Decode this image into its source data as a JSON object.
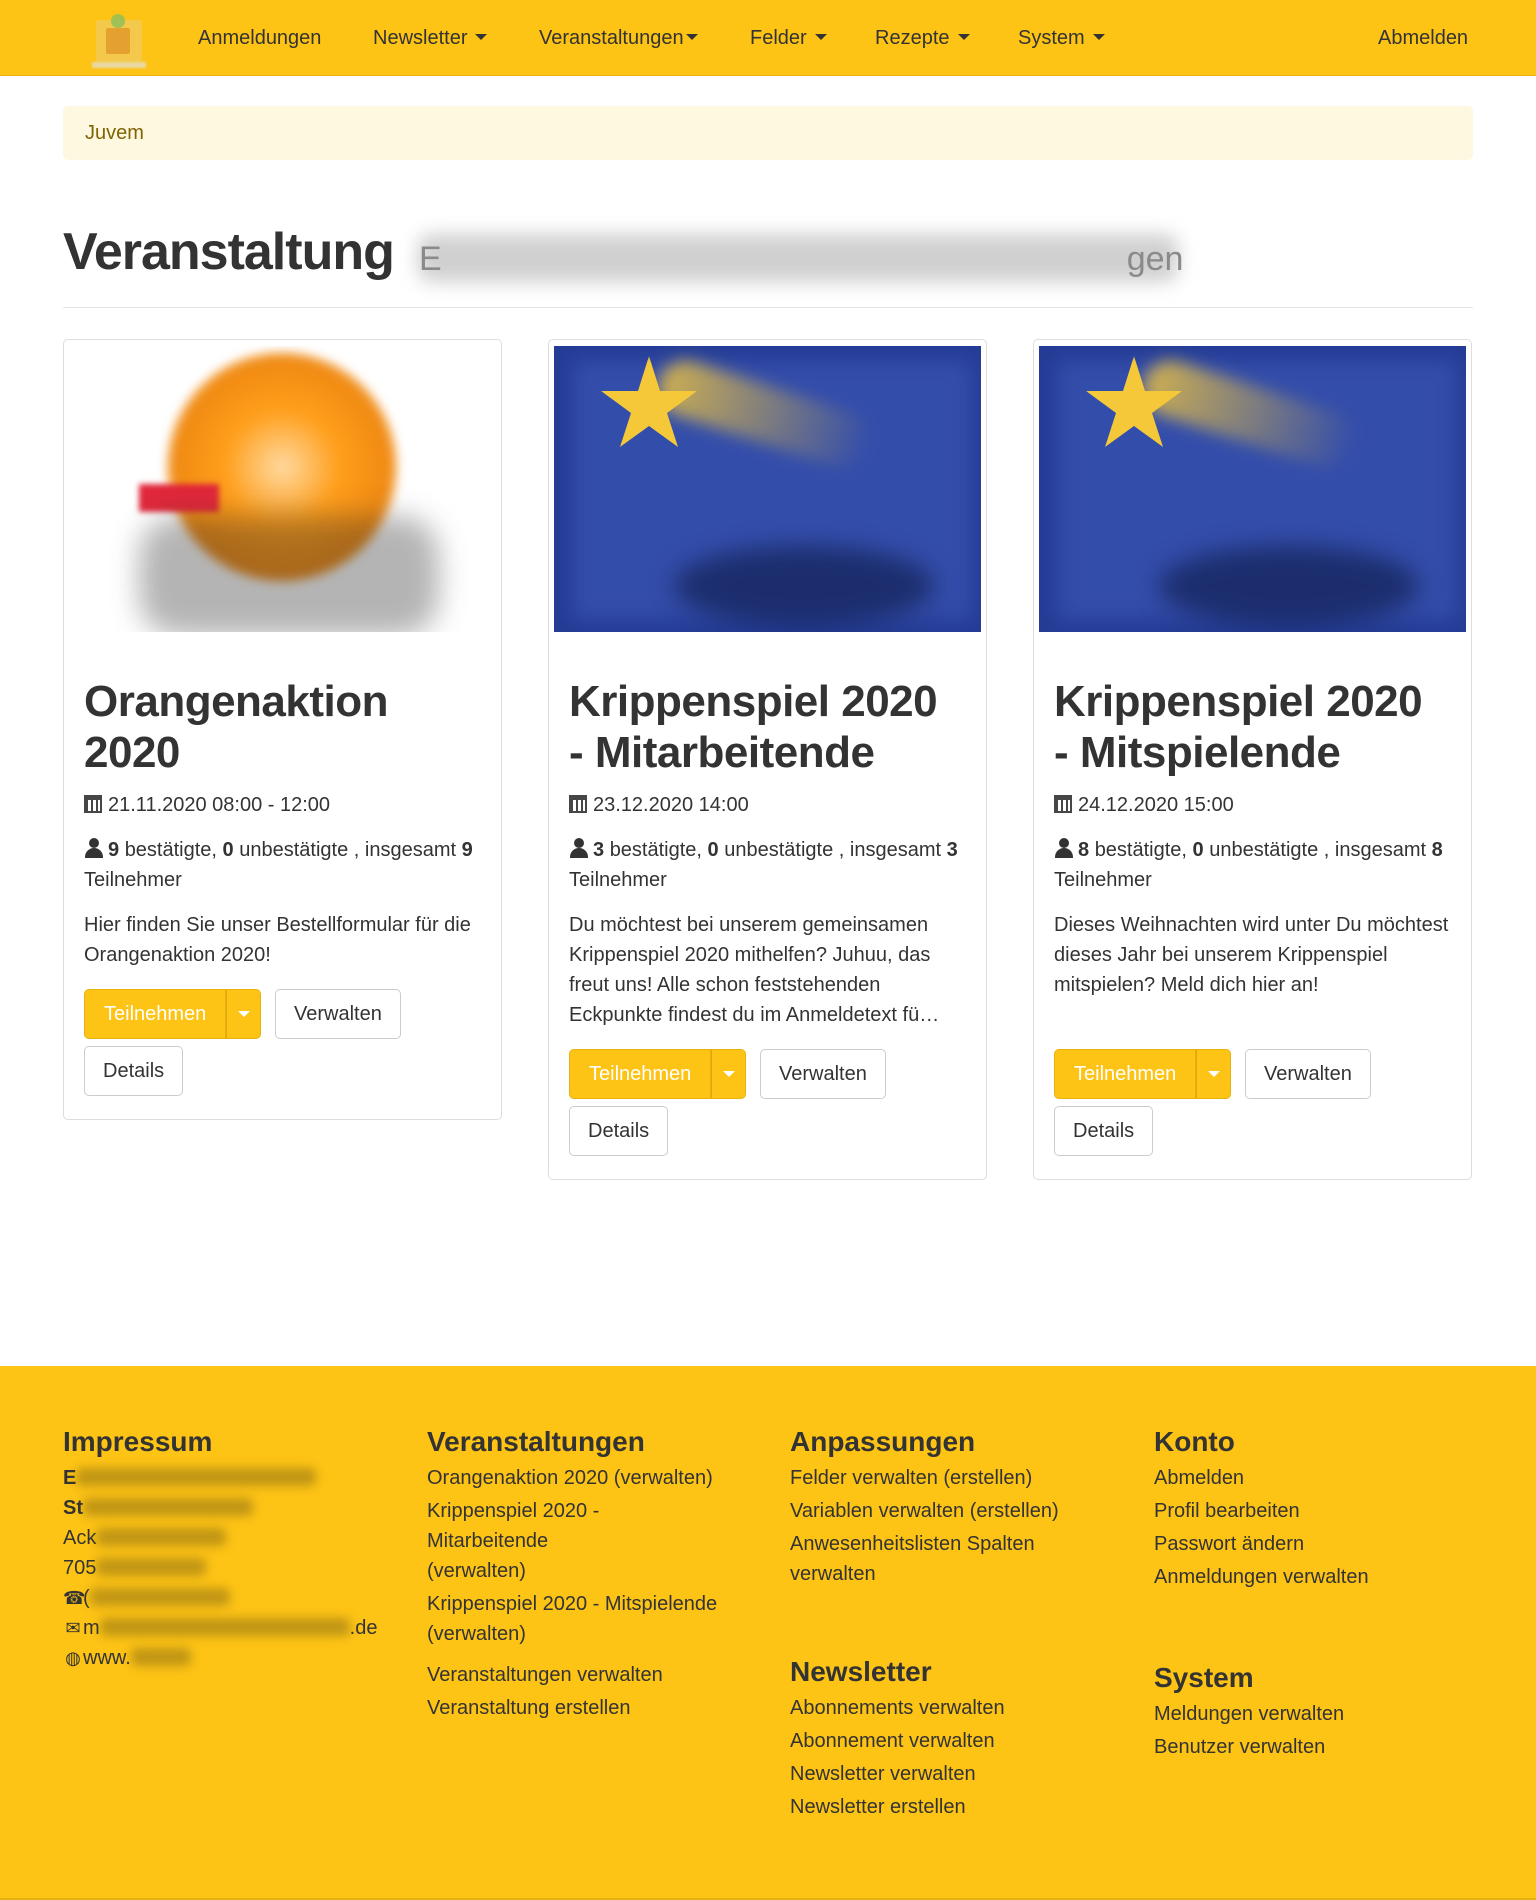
{
  "nav": {
    "items": [
      {
        "label": "Anmeldungen",
        "dropdown": false
      },
      {
        "label": "Newsletter",
        "dropdown": true
      },
      {
        "label": "Veranstaltungen",
        "dropdown": true
      },
      {
        "label": "Felder",
        "dropdown": true
      },
      {
        "label": "Rezepte",
        "dropdown": true
      },
      {
        "label": "System",
        "dropdown": true
      }
    ],
    "logout": "Abmelden"
  },
  "breadcrumb": {
    "label": "Juvem"
  },
  "header": {
    "title": "Veranstaltung",
    "subtitle_visible": "E",
    "subtitle_end": "gen"
  },
  "cards": [
    {
      "title_line1": "Orangenaktion",
      "title_line2": "2020",
      "date": "21.11.2020 08:00 - 12:00",
      "confirmed": "9",
      "confirmed_label": "bestätigte,",
      "unconfirmed": "0",
      "unconfirmed_label": "unbestätigte , insgesamt",
      "total": "9",
      "total_label": "Teilnehmer",
      "description": "Hier finden Sie unser Bestellformular für die Orangenaktion 2020!",
      "primary_button": "Teilnehmen",
      "manage_button": "Verwalten",
      "details_button": "Details"
    },
    {
      "title_line1": "Krippenspiel 2020",
      "title_line2": "- Mitarbeitende",
      "date": "23.12.2020 14:00",
      "confirmed": "3",
      "confirmed_label": "bestätigte,",
      "unconfirmed": "0",
      "unconfirmed_label": "unbestätigte , insgesamt",
      "total": "3",
      "total_label": "Teilnehmer",
      "description": "Du möchtest bei unserem gemeinsamen Krippenspiel 2020 mithelfen? Juhuu, das freut uns! Alle schon feststehenden Eckpunkte findest du im Anmeldetext fü…",
      "primary_button": "Teilnehmen",
      "manage_button": "Verwalten",
      "details_button": "Details"
    },
    {
      "title_line1": "Krippenspiel 2020",
      "title_line2": "- Mitspielende",
      "date": "24.12.2020 15:00",
      "confirmed": "8",
      "confirmed_label": "bestätigte,",
      "unconfirmed": "0",
      "unconfirmed_label": "unbestätigte , insgesamt",
      "total": "8",
      "total_label": "Teilnehmer",
      "description": "Dieses Weihnachten wird unter Du möchtest dieses Jahr bei unserem Krippenspiel mitspielen? Meld dich hier an!",
      "primary_button": "Teilnehmen",
      "manage_button": "Verwalten",
      "details_button": "Details"
    }
  ],
  "footer": {
    "impressum": {
      "heading": "Impressum",
      "line1_visible": "E",
      "line2_visible": "St",
      "line3_visible": "Ack",
      "line4_visible": "705",
      "phone_visible": "(",
      "email_visible": "m",
      "email_end": ".de",
      "web_visible": "www."
    },
    "veranstaltungen": {
      "heading": "Veranstaltungen",
      "links": [
        "Orangenaktion 2020 (verwalten)",
        "Krippenspiel 2020 - Mitarbeitende (verwalten)",
        "Krippenspiel 2020 - Mitspielende (verwalten)"
      ],
      "links2": [
        "Veranstaltungen verwalten",
        "Veranstaltung erstellen"
      ]
    },
    "anpassungen": {
      "heading": "Anpassungen",
      "links": [
        "Felder verwalten (erstellen)",
        "Variablen verwalten (erstellen)",
        "Anwesenheitslisten Spalten verwalten"
      ]
    },
    "newsletter": {
      "heading": "Newsletter",
      "links": [
        "Abonnements verwalten",
        "Abonnement verwalten",
        "Newsletter verwalten",
        "Newsletter erstellen"
      ]
    },
    "konto": {
      "heading": "Konto",
      "links": [
        "Abmelden",
        "Profil bearbeiten",
        "Passwort ändern",
        "Anmeldungen verwalten"
      ]
    },
    "system": {
      "heading": "System",
      "links": [
        "Meldungen verwalten",
        "Benutzer verwalten"
      ]
    }
  },
  "colors": {
    "brand": "#fdc315",
    "breadcrumb_bg": "#fff8e1",
    "text": "#333333"
  },
  "icons": [
    "calendar-icon",
    "user-icon",
    "phone-icon",
    "envelope-icon",
    "globe-icon",
    "caret-down-icon"
  ]
}
